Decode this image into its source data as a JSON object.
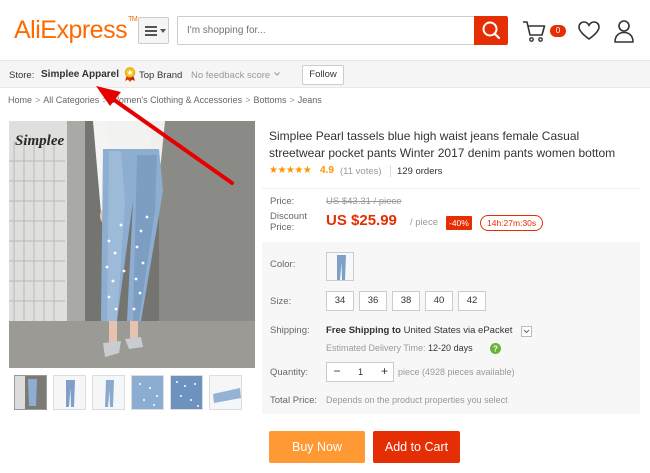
{
  "header": {
    "logo": "AliExpress",
    "logo_tm": "TM",
    "search_placeholder": "I'm shopping for...",
    "cart_count": "0"
  },
  "store": {
    "label": "Store:",
    "name": "Simplee Apparel",
    "top_brand": "Top Brand",
    "feedback": "No feedback score",
    "follow": "Follow"
  },
  "breadcrumb": [
    "Home",
    "All Categories",
    "Women's Clothing & Accessories",
    "Bottoms",
    "Jeans"
  ],
  "gallery": {
    "brand_watermark": "Simplee",
    "thumb_count": 6
  },
  "product": {
    "title": "Simplee Pearl tassels blue high waist jeans female Casual streetwear pocket pants Winter 2017 denim pants women bottom",
    "rating": "4.9",
    "votes": "(11 votes)",
    "orders": "129 orders",
    "price_label": "Price:",
    "old_price": "US $43.31 / piece",
    "discount_label": "Discount Price:",
    "new_price": "US $25.99",
    "per_piece": "/ piece",
    "discount_badge": "-40%",
    "timer": "14h:27m:30s",
    "color_label": "Color:",
    "size_label": "Size:",
    "sizes": [
      "34",
      "36",
      "38",
      "40",
      "42"
    ],
    "shipping_label": "Shipping:",
    "shipping_free": "Free Shipping to",
    "shipping_rest": "United States via ePacket",
    "delivery_label": "Estimated Delivery Time:",
    "delivery_days": "12-20 days",
    "quantity_label": "Quantity:",
    "quantity": "1",
    "quantity_available": "piece (4928 pieces available)",
    "total_label": "Total Price:",
    "total_value": "Depends on the product properties you select",
    "buy_now": "Buy Now",
    "add_to_cart": "Add to Cart"
  },
  "colors": {
    "brand_orange": "#ff6a00",
    "accent_red": "#e62e04",
    "buy_orange": "#ff9933",
    "star": "#ff9400",
    "annotation_arrow": "#e60000"
  }
}
